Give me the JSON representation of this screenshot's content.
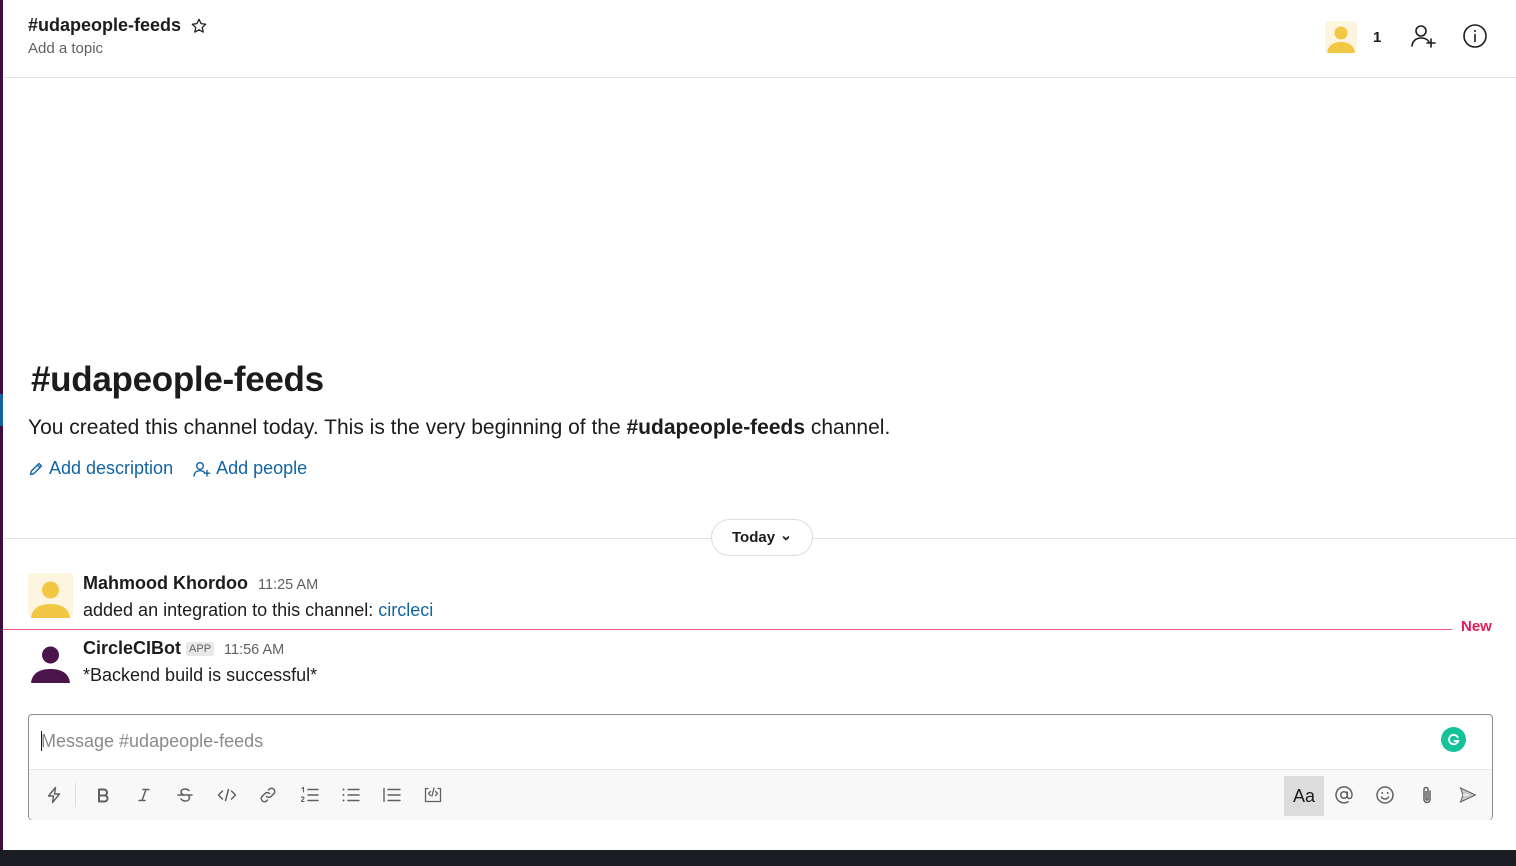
{
  "header": {
    "channel_title": "#udapeople-feeds",
    "topic_placeholder": "Add a topic",
    "member_count": "1",
    "icons": [
      "star-icon",
      "add-member-icon",
      "info-icon"
    ]
  },
  "intro": {
    "title": "#udapeople-feeds",
    "text_before": "You created this channel today. This is the very beginning of the ",
    "channel_name": "#udapeople-feeds",
    "text_after": " channel.",
    "add_description_label": "Add description",
    "add_people_label": "Add people"
  },
  "divider": {
    "day_label": "Today"
  },
  "messages": [
    {
      "author": "Mahmood Khordoo",
      "time": "11:25 AM",
      "text": "added an integration to this channel: ",
      "link_text": "circleci"
    },
    {
      "author": "CircleCIBot",
      "badge": "APP",
      "time": "11:56 AM",
      "text": "*Backend build is successful*"
    }
  ],
  "new_marker": {
    "label": "New"
  },
  "composer": {
    "placeholder": "Message #udapeople-feeds",
    "value": "",
    "format_toggle_label": "Aa",
    "toolbar_icons": [
      "shortcuts-icon",
      "bold-icon",
      "italic-icon",
      "strikethrough-icon",
      "code-icon",
      "link-icon",
      "ordered-list-icon",
      "bulleted-list-icon",
      "blockquote-icon",
      "code-block-icon",
      "mention-icon",
      "emoji-icon",
      "attach-icon",
      "send-icon"
    ]
  },
  "colors": {
    "sidebar_aubergine": "#3f0e40",
    "link_blue": "#1264a3",
    "new_red": "#e01e5a",
    "grammarly_green": "#15c39a",
    "avatar_yellow": "#f2c744",
    "bot_avatar_purple": "#4a154b"
  }
}
